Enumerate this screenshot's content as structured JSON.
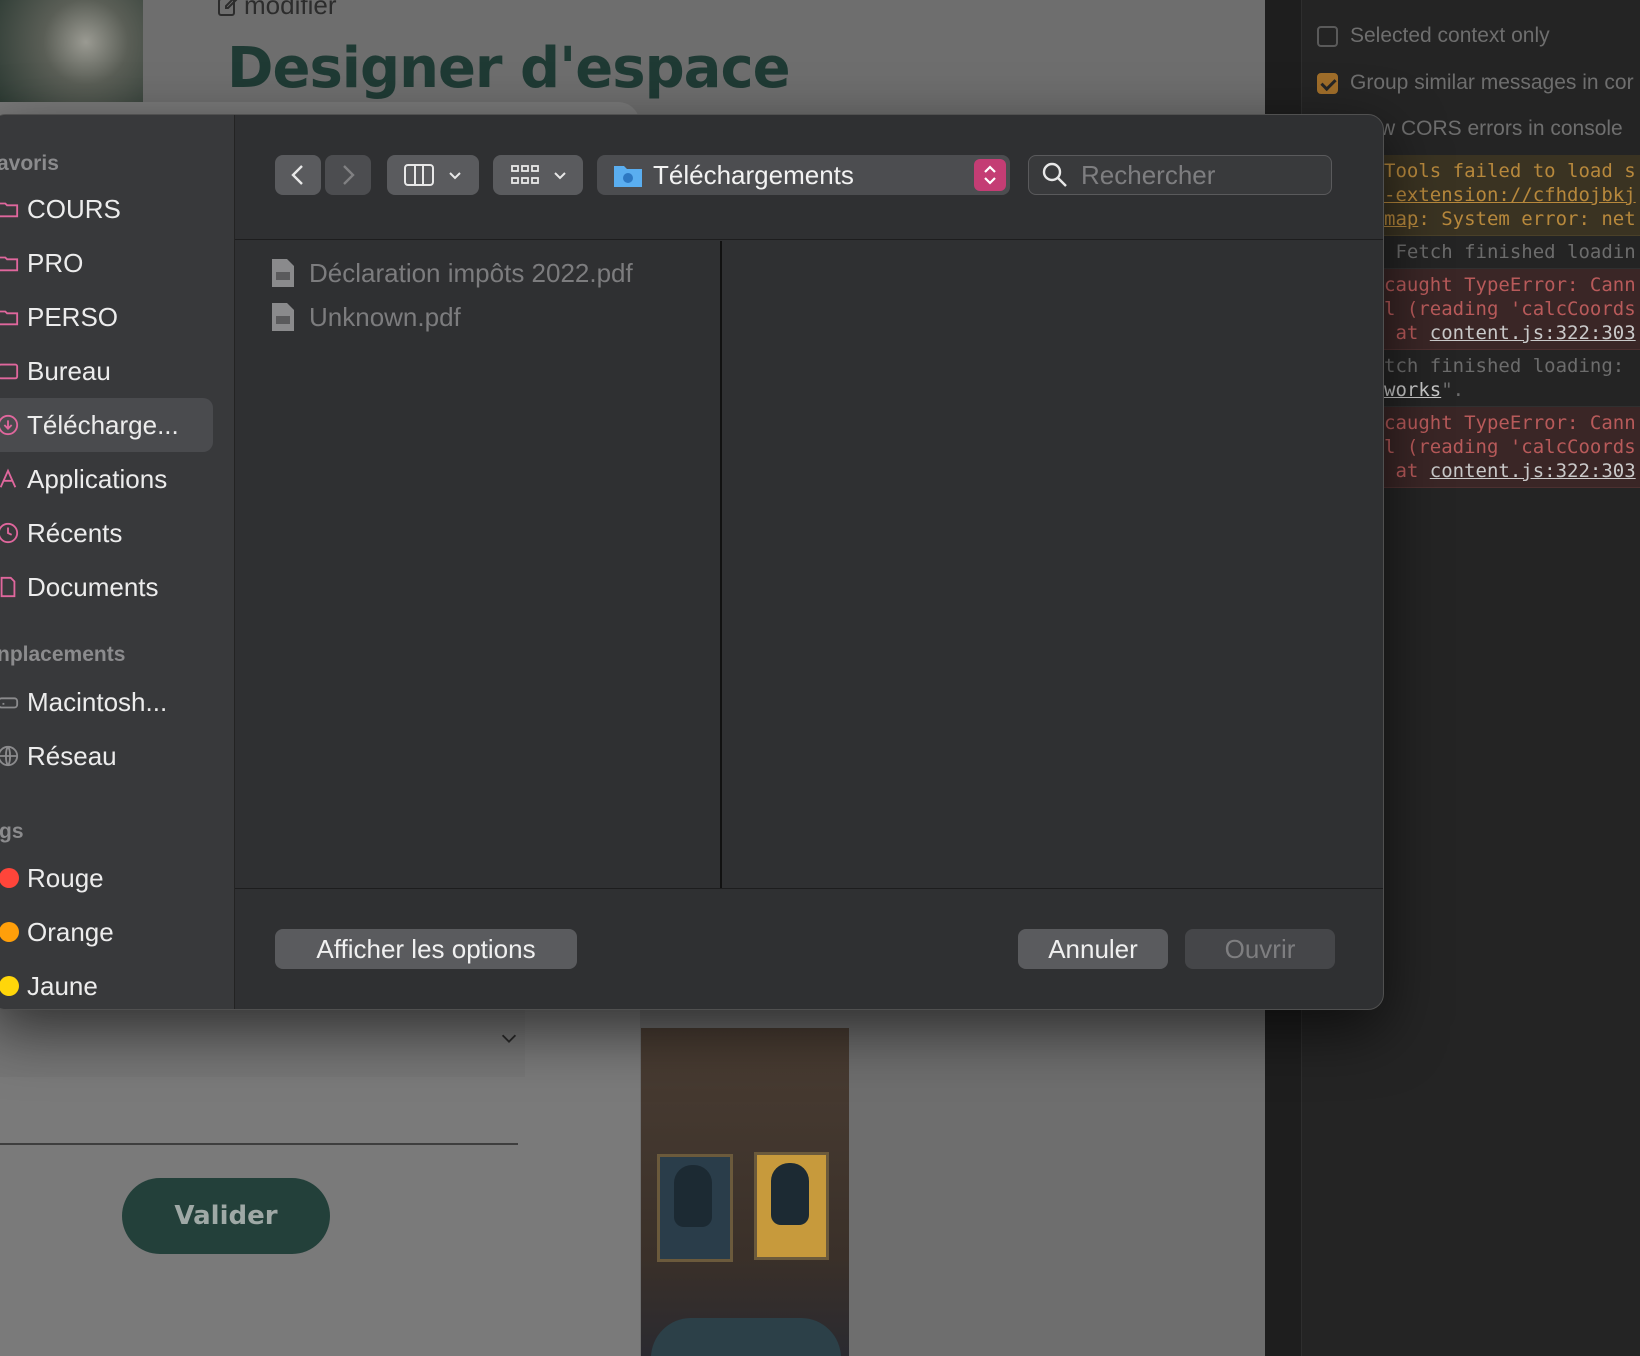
{
  "background_page": {
    "edit_link": "modifier",
    "heading": "Designer d'espace",
    "submit_button": "Valider"
  },
  "devtools": {
    "settings": [
      {
        "label": "Selected context only",
        "checked": false
      },
      {
        "label": "Group similar messages in cor",
        "checked": true
      },
      {
        "label": "w CORS errors in console",
        "checked": false
      }
    ],
    "log_entries": [
      {
        "type": "warn",
        "lines": [
          "Tools failed to load s",
          "-extension://cfhdojbkj",
          "map: System error: net"
        ],
        "links": [
          "-extension://cfhdojbkj",
          "map"
        ]
      },
      {
        "type": "info",
        "lines": [
          " Fetch finished loadin"
        ]
      },
      {
        "type": "error",
        "lines": [
          "caught TypeError: Cann",
          "l (reading 'calcCoords",
          " at content.js:322:303"
        ],
        "link": "content.js:322:303"
      },
      {
        "type": "info",
        "lines": [
          "tch finished loading:",
          "works\"."
        ],
        "link": "works"
      },
      {
        "type": "error",
        "lines": [
          "caught TypeError: Cann",
          "l (reading 'calcCoords",
          " at content.js:322:303"
        ],
        "link": "content.js:322:303"
      }
    ]
  },
  "dialog": {
    "sidebar": {
      "favorites_title": "avoris",
      "favorites": [
        {
          "label": "COURS",
          "icon": "folder-icon"
        },
        {
          "label": "PRO",
          "icon": "folder-icon"
        },
        {
          "label": "PERSO",
          "icon": "folder-icon"
        },
        {
          "label": "Bureau",
          "icon": "desktop-folder-icon"
        },
        {
          "label": "Télécharge...",
          "icon": "download-icon",
          "selected": true
        },
        {
          "label": "Applications",
          "icon": "applications-icon"
        },
        {
          "label": "Récents",
          "icon": "clock-icon"
        },
        {
          "label": "Documents",
          "icon": "document-icon"
        }
      ],
      "locations_title": "nplacements",
      "locations": [
        {
          "label": "Macintosh...",
          "icon": "disk-icon"
        },
        {
          "label": "Réseau",
          "icon": "globe-icon"
        }
      ],
      "tags_title": "gs",
      "tags": [
        {
          "label": "Rouge",
          "color": "#ff453a"
        },
        {
          "label": "Orange",
          "color": "#ff9f0a"
        },
        {
          "label": "Jaune",
          "color": "#ffd60a"
        }
      ]
    },
    "toolbar": {
      "location": "Téléchargements",
      "search_placeholder": "Rechercher"
    },
    "files": [
      {
        "name": "Déclaration impôts 2022.pdf",
        "icon": "pdf-file-icon"
      },
      {
        "name": "Unknown.pdf",
        "icon": "pdf-file-icon"
      }
    ],
    "footer": {
      "options_label": "Afficher les options",
      "cancel_label": "Annuler",
      "open_label": "Ouvrir"
    }
  },
  "colors": {
    "accent": "#c43d74",
    "sidebar_icon": "#e0679d",
    "heading": "#1f3a34",
    "button_green": "#23403a"
  }
}
